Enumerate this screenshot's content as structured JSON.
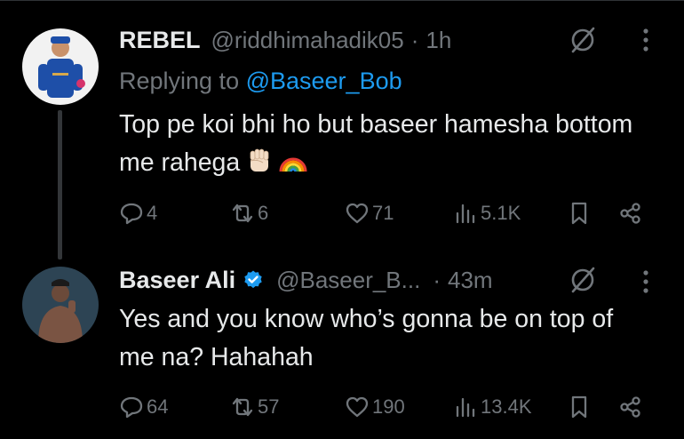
{
  "tweets": [
    {
      "name": "REBEL",
      "handle": "@riddhimahadik05",
      "dot": "·",
      "time": "1h",
      "replying_prefix": "Replying to ",
      "replying_to": "@Baseer_Bob",
      "text": "Top pe koi bhi ho but baseer hamesha bottom me rahega",
      "emojis": [
        "raised-fist-emoji",
        "rainbow-emoji"
      ],
      "stats": {
        "replies": "4",
        "reposts": "6",
        "likes": "71",
        "views": "5.1K"
      }
    },
    {
      "name": "Baseer Ali",
      "verified": true,
      "handle": "@Baseer_B...",
      "dot": "·",
      "time": "43m",
      "text": "Yes and you know who’s gonna be on top of me na? Hahahah",
      "stats": {
        "replies": "64",
        "reposts": "57",
        "likes": "190",
        "views": "13.4K"
      }
    }
  ],
  "colors": {
    "background": "#000000",
    "text": "#e7e9ea",
    "secondary": "#71767b",
    "accent": "#1d9bf0"
  }
}
